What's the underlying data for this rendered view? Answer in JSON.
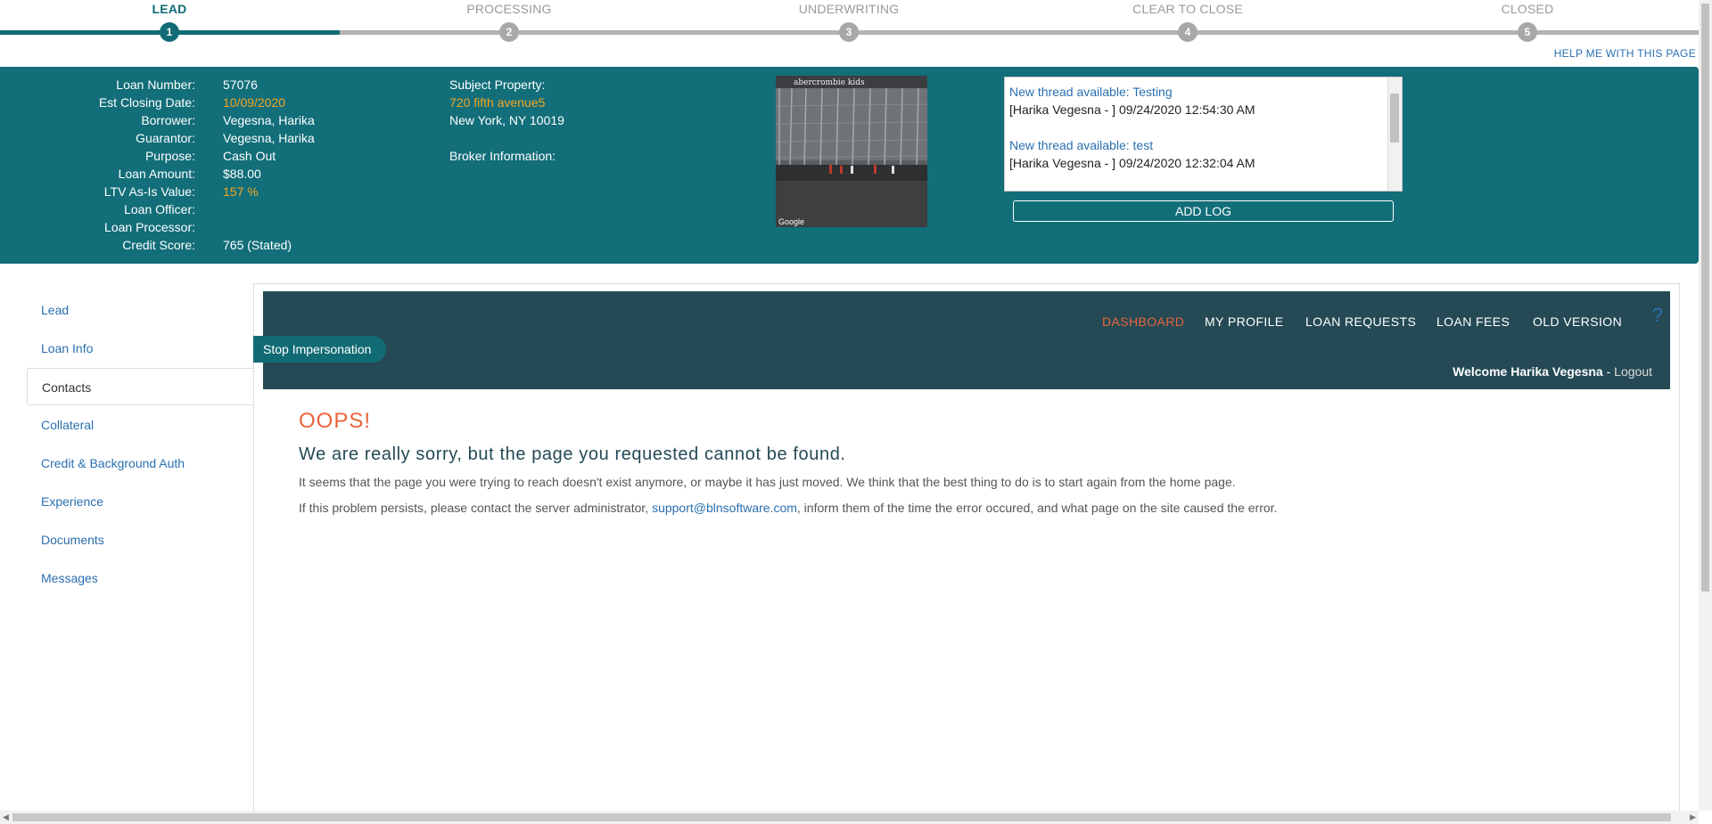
{
  "steps": [
    {
      "label": "LEAD",
      "num": "1"
    },
    {
      "label": "PROCESSING",
      "num": "2"
    },
    {
      "label": "UNDERWRITING",
      "num": "3"
    },
    {
      "label": "CLEAR TO CLOSE",
      "num": "4"
    },
    {
      "label": "CLOSED",
      "num": "5"
    }
  ],
  "help_link": "HELP ME WITH THIS PAGE",
  "loan": {
    "labels": {
      "loan_number": "Loan Number:",
      "est_closing": "Est Closing Date:",
      "borrower": "Borrower:",
      "guarantor": "Guarantor:",
      "purpose": "Purpose:",
      "loan_amount": "Loan Amount:",
      "ltv": "LTV As-Is Value:",
      "loan_officer": "Loan Officer:",
      "loan_processor": "Loan Processor:",
      "credit_score": "Credit Score:"
    },
    "values": {
      "loan_number": "57076",
      "est_closing": "10/09/2020",
      "borrower": "Vegesna, Harika",
      "guarantor": "Vegesna, Harika",
      "purpose": "Cash Out",
      "loan_amount": "$88.00",
      "ltv": "157 %",
      "credit_score": "765 (Stated)"
    },
    "subject_property_label": "Subject Property:",
    "property_line1": "720 fifth avenue5",
    "property_line2": "New York, NY 10019",
    "broker_label": "Broker Information:"
  },
  "logs": [
    {
      "title": "New thread available: Testing",
      "meta": "[Harika Vegesna - ] 09/24/2020 12:54:30 AM"
    },
    {
      "title": "New thread available: test",
      "meta": "[Harika Vegesna - ] 09/24/2020 12:32:04 AM"
    }
  ],
  "add_log_label": "ADD LOG",
  "photo": {
    "sign_text": "abercrombie kids",
    "google_text": "Google"
  },
  "sidebar": [
    {
      "label": "Lead"
    },
    {
      "label": "Loan Info"
    },
    {
      "label": "Contacts"
    },
    {
      "label": "Collateral"
    },
    {
      "label": "Credit & Background Auth"
    },
    {
      "label": "Experience"
    },
    {
      "label": "Documents"
    },
    {
      "label": "Messages"
    }
  ],
  "nav": [
    "DASHBOARD",
    "MY PROFILE",
    "LOAN REQUESTS",
    "LOAN FEES",
    "OLD VERSION"
  ],
  "help_q": "?",
  "welcome": {
    "text": "Welcome Harika Vegesna",
    "sep": " - ",
    "logout": "Logout"
  },
  "stop_impersonation": "Stop Impersonation",
  "error": {
    "oops": "OOPS!",
    "headline": "We are really sorry, but the page you requested cannot be found.",
    "para1": "It seems that the page you were trying to reach doesn't exist anymore, or maybe it has just moved. We think that the best thing to do is to start again from the home page.",
    "para2_pre": "If this problem persists, please contact the server administrator, ",
    "para2_link": "support@blnsoftware.com",
    "para2_post": ", inform them of the time the error occured, and what page on the site caused the error."
  },
  "colors": {
    "teal": "#126e79",
    "dark_nav": "#254a55",
    "accent_orange": "#e8643c",
    "link_blue": "#2a6fb0",
    "highlight": "#f5a623"
  }
}
